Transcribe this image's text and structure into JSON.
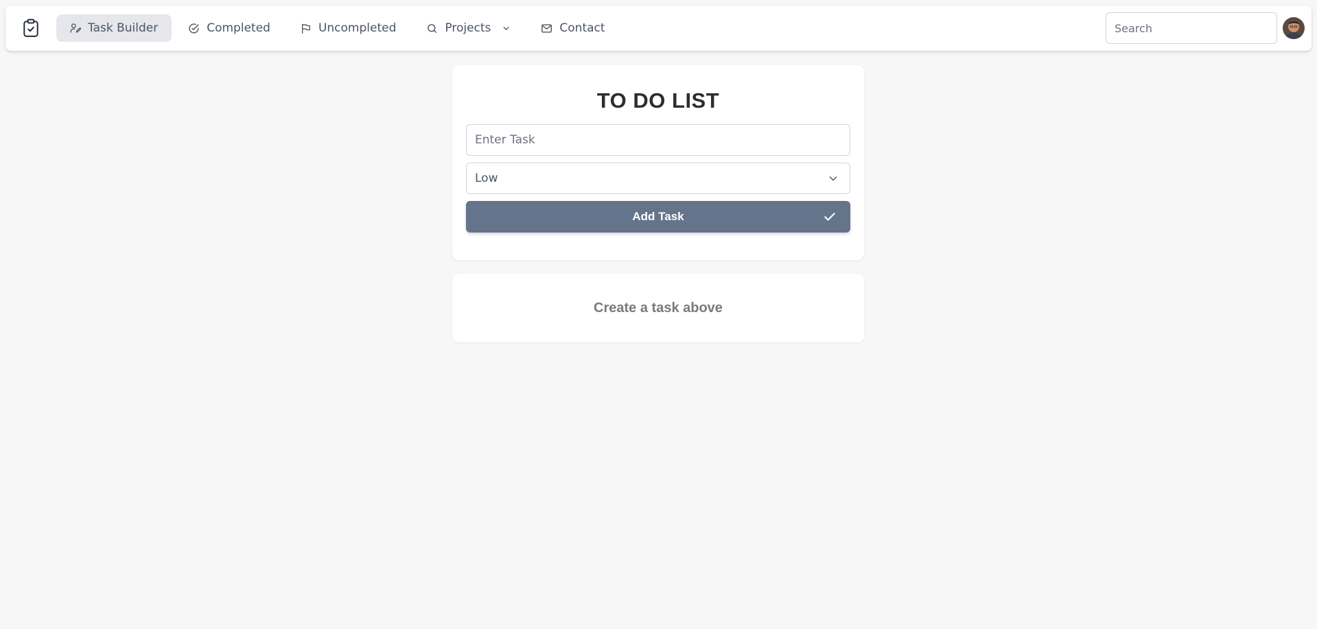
{
  "nav": {
    "items": [
      {
        "label": "Task Builder",
        "icon": "signature-icon",
        "active": true
      },
      {
        "label": "Completed",
        "icon": "check-circle-icon"
      },
      {
        "label": "Uncompleted",
        "icon": "flag-icon"
      },
      {
        "label": "Projects",
        "icon": "search-icon",
        "has_dropdown": true
      },
      {
        "label": "Contact",
        "icon": "mail-icon"
      }
    ],
    "logo_icon": "clipboard-check-icon",
    "search_placeholder": "Search"
  },
  "todo": {
    "title": "TO DO LIST",
    "task_placeholder": "Enter Task",
    "priority_selected": "Low",
    "add_button_label": "Add Task"
  },
  "empty_state": {
    "message": "Create a task above"
  },
  "colors": {
    "page_bg": "#f7f7f7",
    "active_nav_bg": "#e5e7eb",
    "button_bg": "#64748b",
    "title_text": "#2d2d2d",
    "muted_text": "#7a7a7a"
  }
}
